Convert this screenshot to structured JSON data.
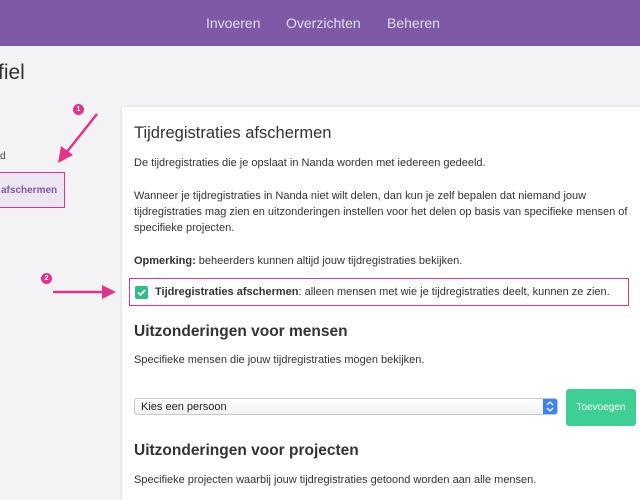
{
  "nav": {
    "items": [
      "Invoeren",
      "Overzichten",
      "Beheren"
    ]
  },
  "page": {
    "title": "fiel"
  },
  "sidebar": {
    "partial_label": "d",
    "active_item": "afschermen"
  },
  "panel": {
    "title": "Tijdregistraties afschermen",
    "intro": "De tijdregistraties die je opslaat in Nanda worden met iedereen gedeeld.",
    "description_lines": [
      "Wanneer je tijdregistraties in Nanda niet wilt delen, dan kun je zelf bepalen dat niemand jouw",
      "tijdregistraties mag zien en uitzonderingen instellen voor het delen op basis van specifieke mensen of",
      "specifieke projecten."
    ],
    "note_label": "Opmerking:",
    "note_text": " beheerders kunnen altijd jouw tijdregistraties bekijken.",
    "checkbox": {
      "checked": true,
      "label_bold": "Tijdregistraties afschermen",
      "label_rest": ": alleen mensen met wie je tijdregistraties deelt, kunnen ze zien."
    },
    "people_section": {
      "title": "Uitzonderingen voor mensen",
      "description": "Specifieke mensen die jouw tijdregistraties mogen bekijken.",
      "select_value": "Kies een persoon",
      "add_button": "Toevoegen"
    },
    "projects_section": {
      "title": "Uitzonderingen voor projecten",
      "description": "Specifieke projecten waarbij jouw tijdregistraties getoond worden aan alle mensen."
    }
  },
  "annotations": {
    "markers": [
      "1",
      "2"
    ],
    "color": "#e0338a"
  },
  "colors": {
    "topbar": "#7e5aa6",
    "accent_green": "#3ecf94",
    "highlight": "#e0338a"
  }
}
